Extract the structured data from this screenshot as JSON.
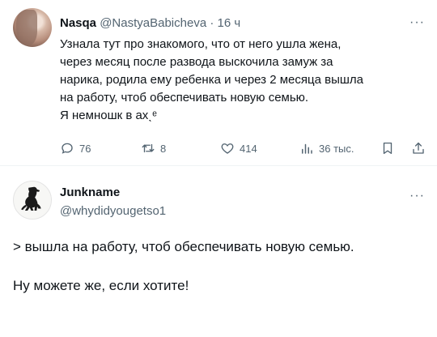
{
  "tweet": {
    "author_name": "Nasqa",
    "author_handle": "@NastyaBabicheva",
    "separator": "·",
    "time": "16 ч",
    "more": "···",
    "lines": [
      "Узнала тут про знакомого, что от него ушла жена,",
      "через месяц после развода выскочила замуж за",
      "нарика, родила ему ребенка и через 2 месяца вышла",
      "на работу, чтоб обеспечивать новую семью.",
      "Я немношк в ахˎᵉ"
    ],
    "actions": {
      "replies": "76",
      "reposts": "8",
      "likes": "414",
      "views": "36 тыс."
    },
    "icons": [
      "reply-icon",
      "repost-icon",
      "like-icon",
      "views-icon",
      "bookmark-icon",
      "share-icon"
    ],
    "colors": {
      "text": "#0f1419",
      "secondary": "#536471",
      "divider": "#eff3f4"
    }
  },
  "reply": {
    "author_name": "Junkname",
    "author_handle": "@whydidyougetso1",
    "more": "···",
    "quote_line": "> вышла на работу, чтоб обеспечивать новую семью.",
    "body_line": "Ну можете же, если хотите!"
  }
}
